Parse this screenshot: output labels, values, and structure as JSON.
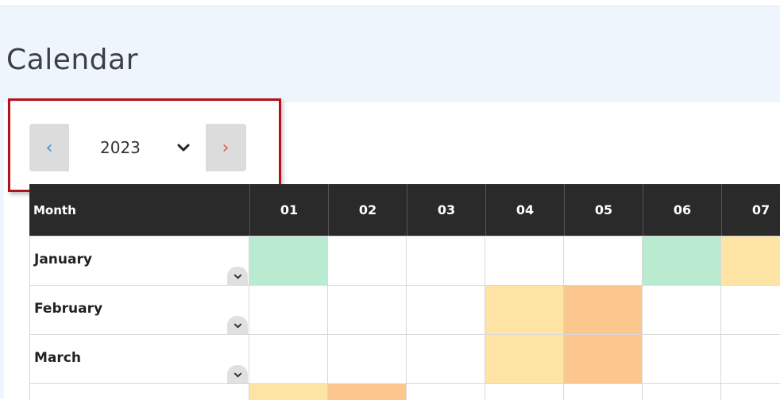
{
  "page": {
    "title": "Calendar"
  },
  "year_nav": {
    "prev_icon": "chevron-left-icon",
    "next_icon": "chevron-right-icon",
    "selected_year": "2023",
    "dropdown_icon": "chevron-down-icon"
  },
  "grid": {
    "month_header": "Month",
    "days": [
      "01",
      "02",
      "03",
      "04",
      "05",
      "06",
      "07"
    ],
    "colors": {
      "green": "#b8ebd0",
      "yellow": "#fde4a4",
      "orange": "#fcc78f",
      "empty": "#ffffff"
    },
    "rows": [
      {
        "month": "January",
        "cells": [
          "green",
          "empty",
          "empty",
          "empty",
          "empty",
          "green",
          "yellow"
        ]
      },
      {
        "month": "February",
        "cells": [
          "empty",
          "empty",
          "empty",
          "yellow",
          "orange",
          "empty",
          "empty"
        ]
      },
      {
        "month": "March",
        "cells": [
          "empty",
          "empty",
          "empty",
          "yellow",
          "orange",
          "empty",
          "empty"
        ]
      },
      {
        "month": "",
        "cells": [
          "yellow",
          "orange",
          "empty",
          "empty",
          "empty",
          "empty",
          "empty"
        ]
      }
    ]
  }
}
